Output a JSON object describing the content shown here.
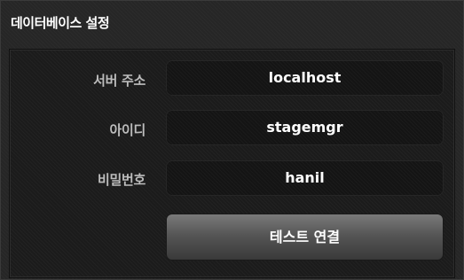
{
  "panel": {
    "title": "데이터베이스 설정"
  },
  "form": {
    "server_label": "서버 주소",
    "server_value": "localhost",
    "id_label": "아이디",
    "id_value": "stagemgr",
    "password_label": "비밀번호",
    "password_value": "hanil",
    "test_button_label": "테스트 연결"
  }
}
